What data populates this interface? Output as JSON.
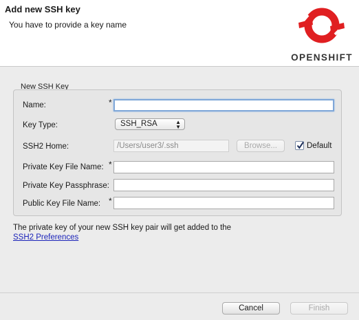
{
  "header": {
    "title": "Add new SSH key",
    "message": "You have to provide a key name",
    "logo_text": "OPENSHIFT",
    "logo_color": "#e01f21"
  },
  "group": {
    "title": "New SSH Key"
  },
  "form": {
    "name_label": "Name:",
    "name_required": "*",
    "name_value": "",
    "key_type_label": "Key Type:",
    "key_type_value": "SSH_RSA",
    "ssh2_home_label": "SSH2 Home:",
    "ssh2_home_value": "/Users/user3/.ssh",
    "browse_label": "Browse...",
    "default_label": "Default",
    "default_checked": true,
    "private_key_label": "Private Key File Name:",
    "private_key_required": "*",
    "private_key_value": "",
    "passphrase_label": "Private Key Passphrase:",
    "passphrase_value": "",
    "public_key_label": "Public Key File Name:",
    "public_key_required": "*",
    "public_key_value": ""
  },
  "info": {
    "text": "The private key of your new SSH key pair will get added to the",
    "link": "SSH2 Preferences"
  },
  "footer": {
    "cancel_label": "Cancel",
    "finish_label": "Finish"
  }
}
